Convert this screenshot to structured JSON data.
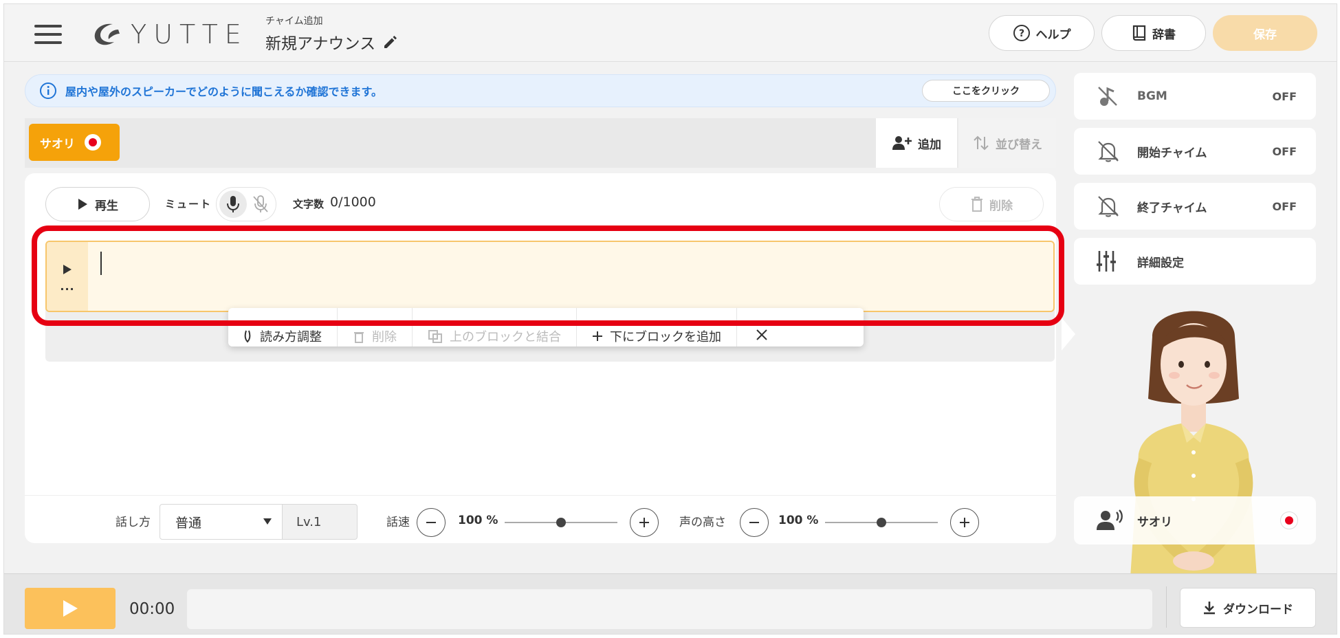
{
  "header": {
    "logo_text": "YUTTE",
    "subtitle": "チャイム追加",
    "title": "新規アナウンス",
    "help_label": "ヘルプ",
    "dict_label": "辞書",
    "save_label": "保存"
  },
  "info": {
    "text": "屋内や屋外のスピーカーでどのように聞こえるか確認できます。",
    "button": "ここをクリック"
  },
  "speakers": {
    "active_tab": "サオリ",
    "add_label": "追加",
    "sort_label": "並び替え"
  },
  "editor": {
    "play_label": "再生",
    "mute_label": "ミュート",
    "count_label": "文字数",
    "count_value": "0/1000",
    "delete_label": "削除",
    "more_icon": "...",
    "float_bar": {
      "adjust_reading": "読み方調整",
      "delete": "削除",
      "merge_above": "上のブロックと結合",
      "add_below": "下にブロックを追加"
    }
  },
  "controls": {
    "style_label": "話し方",
    "style_value": "普通",
    "level": "Lv.1",
    "speed_label": "話速",
    "speed_value": "100 %",
    "speed_fraction": 0.5,
    "pitch_label": "声の高さ",
    "pitch_value": "100 %",
    "pitch_fraction": 0.5
  },
  "sidebar": {
    "bgm_label": "BGM",
    "bgm_state": "OFF",
    "start_chime_label": "開始チャイム",
    "start_chime_state": "OFF",
    "end_chime_label": "終了チャイム",
    "end_chime_state": "OFF",
    "detail_label": "詳細設定",
    "speaker_name": "サオリ"
  },
  "footer": {
    "time": "00:00",
    "download_label": "ダウンロード"
  },
  "colors": {
    "accent": "#f5a20a",
    "save_disabled": "#f8dba9",
    "info_blue": "#1f74d6",
    "highlight_red": "#e60012",
    "play_yellow": "#fcc15b"
  },
  "icons": [
    "hamburger-icon",
    "logo-icon",
    "pencil-icon",
    "help-icon",
    "book-icon",
    "info-icon",
    "record-icon",
    "add-user-icon",
    "sort-icon",
    "play-icon",
    "mic-icon",
    "mic-off-icon",
    "trash-icon",
    "more-icon",
    "close-icon",
    "minus-icon",
    "plus-icon",
    "music-off-icon",
    "bell-off-icon",
    "sliders-icon",
    "speaker-voice-icon",
    "download-icon"
  ]
}
